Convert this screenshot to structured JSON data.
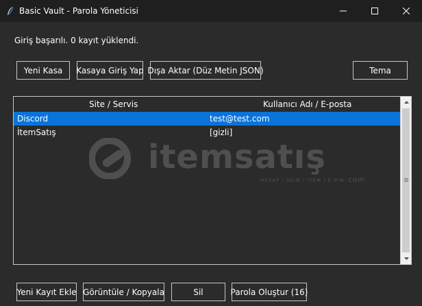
{
  "window": {
    "title": "Basic Vault - Parola Yöneticisi",
    "icon": "feather-icon",
    "controls": [
      "minimize-icon",
      "maximize-icon",
      "close-icon"
    ]
  },
  "status": "Giriş başarılı. 0 kayıt yüklendi.",
  "toolbar": {
    "new_vault": "Yeni Kasa",
    "vault_login": "Kasaya Giriş Yap",
    "export": "Dışa Aktar (Düz Metin JSON)",
    "theme": "Tema"
  },
  "table": {
    "columns": [
      "Site / Servis",
      "Kullanıcı Adı / E-posta"
    ],
    "rows": [
      {
        "site": "Discord",
        "user": "test@test.com",
        "selected": true
      },
      {
        "site": "İtemSatış",
        "user": "[gizli]",
        "selected": false
      }
    ],
    "selection_color": "#0a74da"
  },
  "watermark": {
    "brand": "itemsatış",
    "tagline": "HESAP / SKIN / ITEM / E-PIN",
    "domain": ".com"
  },
  "actions": {
    "add": "Yeni Kayıt Ekle",
    "view_copy": "Görüntüle / Kopyala",
    "delete": "Sil",
    "generate": "Parola Oluştur (16)"
  }
}
